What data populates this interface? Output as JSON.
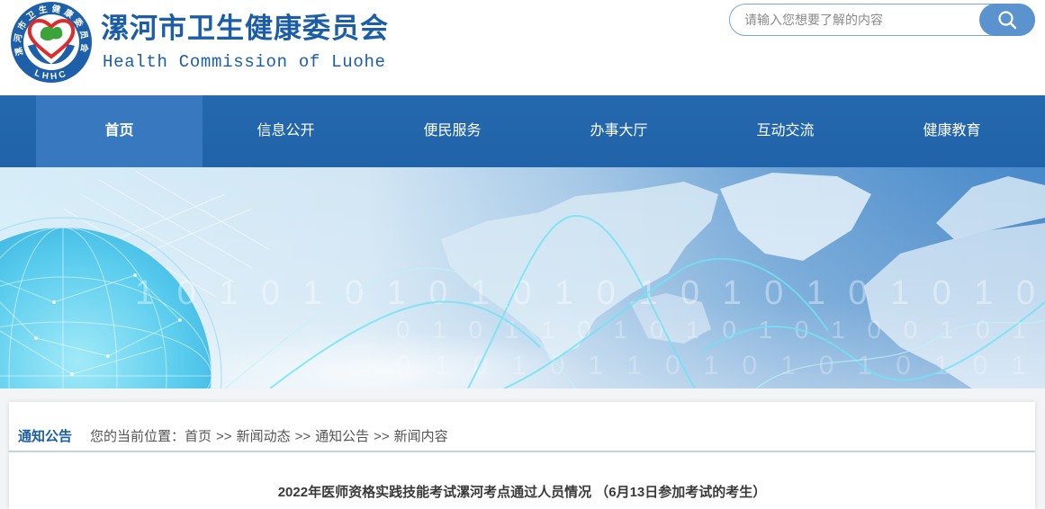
{
  "site": {
    "title": "漯河市卫生健康委员会",
    "subtitle": "Health Commission of Luohe",
    "logo": {
      "ring_text": "漯河市卫生健康委员会",
      "abbr": "LHHC"
    }
  },
  "search": {
    "placeholder": "请输入您想要了解的内容",
    "value": ""
  },
  "nav": {
    "items": [
      {
        "label": "首页",
        "active": true
      },
      {
        "label": "信息公开",
        "active": false
      },
      {
        "label": "便民服务",
        "active": false
      },
      {
        "label": "办事大厅",
        "active": false
      },
      {
        "label": "互动交流",
        "active": false
      },
      {
        "label": "健康教育",
        "active": false
      }
    ]
  },
  "banner": {
    "binary_rows": [
      "1 0 1 0 1 0 1 0 1 0 1 0 1 0 1 0 1 0 1 0 1 0",
      "0 1 0 1 1 0 1 0 1 0 1 0 1 0 0 1 0 1",
      "0 1 0 1 0 1 1 0 1 0 1 0 1 0 1 0 1"
    ]
  },
  "section": {
    "label": "通知公告"
  },
  "breadcrumb": {
    "prefix": "您的当前位置：",
    "separator": ">>",
    "items": [
      "首页",
      "新闻动态",
      "通知公告",
      "新闻内容"
    ]
  },
  "article": {
    "title": "2022年医师资格实践技能考试漯河考点通过人员情况 （6月13日参加考试的考生）"
  },
  "colors": {
    "brand": "#1b5ea7",
    "nav_bg": "#2163a9",
    "nav_active": "#3878be",
    "accent": "#5a93cd"
  }
}
